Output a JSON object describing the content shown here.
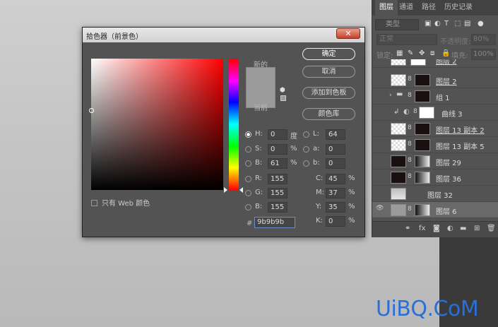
{
  "dialog": {
    "title": "拾色器（前景色）",
    "close_symbol": "✕",
    "new_label": "新的",
    "current_label": "当前",
    "buttons": {
      "ok": "确定",
      "cancel": "取消",
      "add_swatch": "添加到色板",
      "color_library": "颜色库"
    },
    "web_only_label": "只有 Web 颜色",
    "fields": {
      "H": {
        "label": "H:",
        "value": "0",
        "unit": "度"
      },
      "S": {
        "label": "S:",
        "value": "0",
        "unit": "%"
      },
      "Bv": {
        "label": "B:",
        "value": "61",
        "unit": "%"
      },
      "R": {
        "label": "R:",
        "value": "155"
      },
      "G": {
        "label": "G:",
        "value": "155"
      },
      "Bc": {
        "label": "B:",
        "value": "155"
      },
      "L": {
        "label": "L:",
        "value": "64"
      },
      "a": {
        "label": "a:",
        "value": "0"
      },
      "b": {
        "label": "b:",
        "value": "0"
      },
      "C": {
        "label": "C:",
        "value": "45",
        "unit": "%"
      },
      "M": {
        "label": "M:",
        "value": "37",
        "unit": "%"
      },
      "Y": {
        "label": "Y:",
        "value": "35",
        "unit": "%"
      },
      "K": {
        "label": "K:",
        "value": "0",
        "unit": "%"
      }
    },
    "hex_label": "#",
    "hex_value": "9b9b9b",
    "current_color": "#9b9b9b",
    "selected_mode": "H"
  },
  "panel": {
    "tabs": [
      "图层",
      "通道",
      "路径",
      "历史记录"
    ],
    "active_tab": "图层",
    "kind_placeholder": "类型",
    "blend_mode": "正常",
    "opacity_label": "不透明度:",
    "opacity_value": "80%",
    "lock_label": "锁定:",
    "fill_label": "填充:",
    "fill_value": "100%",
    "layers": [
      {
        "name": "图层 2",
        "partial": true
      },
      {
        "name": "图层 2",
        "underline": true
      },
      {
        "name": "组 1"
      },
      {
        "name": "曲线 3"
      },
      {
        "name": "图层 13 副本 2",
        "underline": true
      },
      {
        "name": "图层 13 副本 5"
      },
      {
        "name": "图层 29"
      },
      {
        "name": "图层 36"
      },
      {
        "name": "图层 32"
      },
      {
        "name": "图层 6",
        "selected": true
      }
    ]
  },
  "watermark": "UiBQ.CoM"
}
